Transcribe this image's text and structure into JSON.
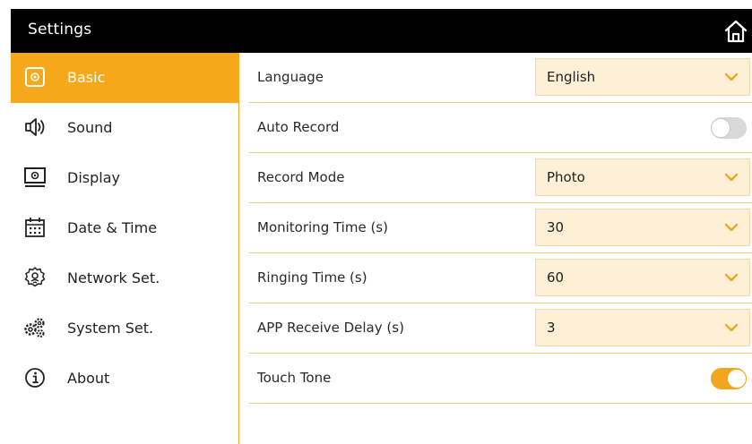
{
  "header": {
    "title": "Settings",
    "home_icon": "home-icon"
  },
  "colors": {
    "accent": "#f5a81a",
    "header_bg": "#000000",
    "select_bg": "#fdf0d6",
    "divider": "#f6cd86",
    "toggle_off": "#d9d9d9",
    "toggle_on": "#f3a51f"
  },
  "sidebar": {
    "items": [
      {
        "label": "Basic",
        "icon": "basic-settings-icon",
        "active": true
      },
      {
        "label": "Sound",
        "icon": "speaker-icon",
        "active": false
      },
      {
        "label": "Display",
        "icon": "display-icon",
        "active": false
      },
      {
        "label": "Date & Time",
        "icon": "calendar-icon",
        "active": false
      },
      {
        "label": "Network Set.",
        "icon": "network-gear-icon",
        "active": false
      },
      {
        "label": "System Set.",
        "icon": "gears-icon",
        "active": false
      },
      {
        "label": "About",
        "icon": "info-icon",
        "active": false
      }
    ]
  },
  "settings": {
    "language": {
      "label": "Language",
      "value": "English"
    },
    "auto_record": {
      "label": "Auto Record",
      "enabled": false
    },
    "record_mode": {
      "label": "Record Mode",
      "value": "Photo"
    },
    "monitoring_time": {
      "label": "Monitoring Time (s)",
      "value": "30"
    },
    "ringing_time": {
      "label": "Ringing Time (s)",
      "value": "60"
    },
    "app_receive_delay": {
      "label": "APP Receive Delay (s)",
      "value": "3"
    },
    "touch_tone": {
      "label": "Touch Tone",
      "enabled": true
    }
  }
}
